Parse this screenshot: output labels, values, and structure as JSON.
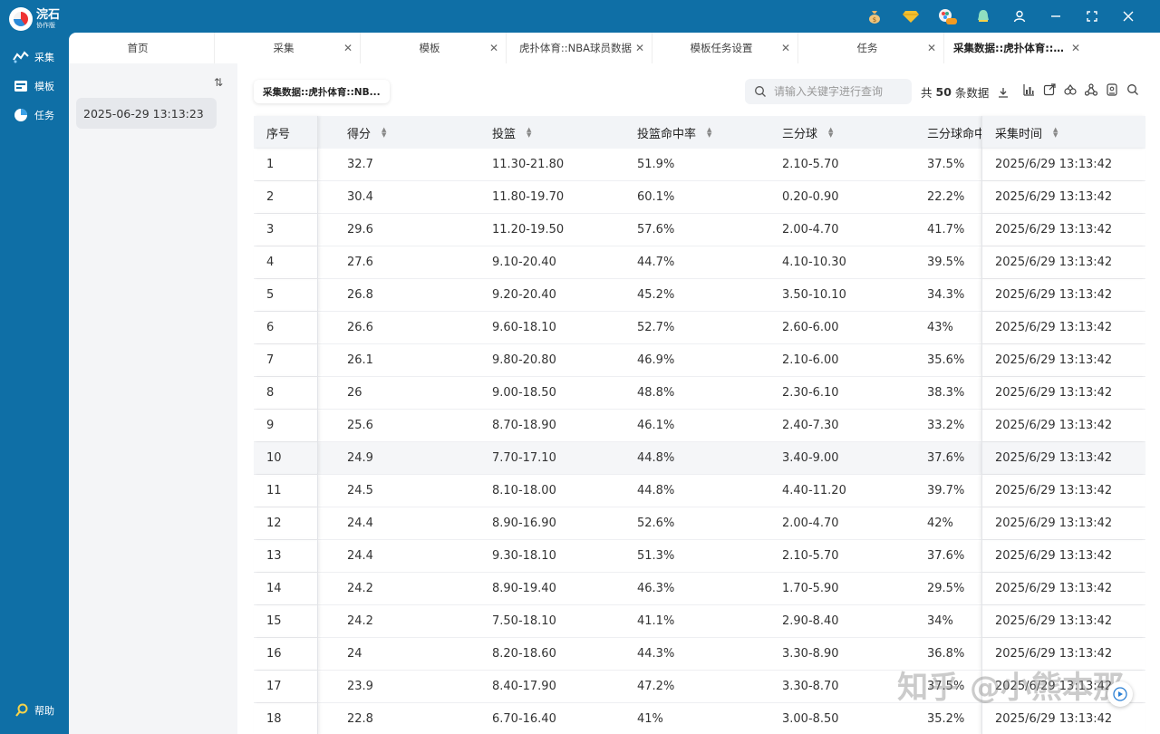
{
  "app": {
    "name": "浣石",
    "edition": "协作版"
  },
  "sidebar": {
    "items": [
      {
        "label": "采集",
        "icon": "collect-icon"
      },
      {
        "label": "模板",
        "icon": "template-icon"
      },
      {
        "label": "任务",
        "icon": "task-icon"
      }
    ],
    "help_label": "帮助"
  },
  "topbar": {
    "icons": [
      "money-bag-icon",
      "diamond-icon",
      "beta-badge-icon",
      "notification-bell-icon",
      "user-icon",
      "minimize-icon",
      "maximize-icon",
      "close-icon"
    ]
  },
  "tabs": [
    {
      "label": "首页",
      "closable": false
    },
    {
      "label": "采集",
      "closable": true
    },
    {
      "label": "模板",
      "closable": true
    },
    {
      "label": "虎扑体育::NBA球员数据",
      "closable": true
    },
    {
      "label": "模板任务设置",
      "closable": true
    },
    {
      "label": "任务",
      "closable": true
    },
    {
      "label": "采集数据::虎扑体育::NB...",
      "closable": true,
      "active": true
    }
  ],
  "left_panel": {
    "selected_date": "2025-06-29 13:13:23"
  },
  "content": {
    "dataset_chip": "采集数据::虎扑体育::NB...",
    "search_placeholder": "请输入关键字进行查询",
    "count_prefix": "共",
    "count_value": "50",
    "count_suffix": "条数据"
  },
  "table": {
    "columns": [
      "序号",
      "得分",
      "投篮",
      "投篮命中率",
      "三分球",
      "三分球命中率",
      "采集时间"
    ],
    "rows": [
      [
        "1",
        "32.7",
        "11.30-21.80",
        "51.9%",
        "2.10-5.70",
        "37.5%",
        "2025/6/29 13:13:42"
      ],
      [
        "2",
        "30.4",
        "11.80-19.70",
        "60.1%",
        "0.20-0.90",
        "22.2%",
        "2025/6/29 13:13:42"
      ],
      [
        "3",
        "29.6",
        "11.20-19.50",
        "57.6%",
        "2.00-4.70",
        "41.7%",
        "2025/6/29 13:13:42"
      ],
      [
        "4",
        "27.6",
        "9.10-20.40",
        "44.7%",
        "4.10-10.30",
        "39.5%",
        "2025/6/29 13:13:42"
      ],
      [
        "5",
        "26.8",
        "9.20-20.40",
        "45.2%",
        "3.50-10.10",
        "34.3%",
        "2025/6/29 13:13:42"
      ],
      [
        "6",
        "26.6",
        "9.60-18.10",
        "52.7%",
        "2.60-6.00",
        "43%",
        "2025/6/29 13:13:42"
      ],
      [
        "7",
        "26.1",
        "9.80-20.80",
        "46.9%",
        "2.10-6.00",
        "35.6%",
        "2025/6/29 13:13:42"
      ],
      [
        "8",
        "26",
        "9.00-18.50",
        "48.8%",
        "2.30-6.10",
        "38.3%",
        "2025/6/29 13:13:42"
      ],
      [
        "9",
        "25.6",
        "8.70-18.90",
        "46.1%",
        "2.40-7.30",
        "33.2%",
        "2025/6/29 13:13:42"
      ],
      [
        "10",
        "24.9",
        "7.70-17.10",
        "44.8%",
        "3.40-9.00",
        "37.6%",
        "2025/6/29 13:13:42"
      ],
      [
        "11",
        "24.5",
        "8.10-18.00",
        "44.8%",
        "4.40-11.20",
        "39.7%",
        "2025/6/29 13:13:42"
      ],
      [
        "12",
        "24.4",
        "8.90-16.90",
        "52.6%",
        "2.00-4.70",
        "42%",
        "2025/6/29 13:13:42"
      ],
      [
        "13",
        "24.4",
        "9.30-18.10",
        "51.3%",
        "2.10-5.70",
        "37.6%",
        "2025/6/29 13:13:42"
      ],
      [
        "14",
        "24.2",
        "8.90-19.40",
        "46.3%",
        "1.70-5.90",
        "29.5%",
        "2025/6/29 13:13:42"
      ],
      [
        "15",
        "24.2",
        "7.50-18.10",
        "41.1%",
        "2.90-8.40",
        "34%",
        "2025/6/29 13:13:42"
      ],
      [
        "16",
        "24",
        "8.20-18.60",
        "44.3%",
        "3.30-8.90",
        "36.8%",
        "2025/6/29 13:13:42"
      ],
      [
        "17",
        "23.9",
        "8.40-17.90",
        "47.2%",
        "3.30-8.70",
        "37.5%",
        "2025/6/29 13:13:42"
      ],
      [
        "18",
        "22.8",
        "6.70-16.40",
        "41%",
        "3.00-8.50",
        "35.2%",
        "2025/6/29 13:13:42"
      ]
    ],
    "highlighted_row": 9
  },
  "watermark": "知乎 @小熊本那",
  "colors": {
    "primary": "#0f6fa6",
    "header_bg": "#f2f4f7",
    "panel_bg": "#f4f5f7"
  }
}
